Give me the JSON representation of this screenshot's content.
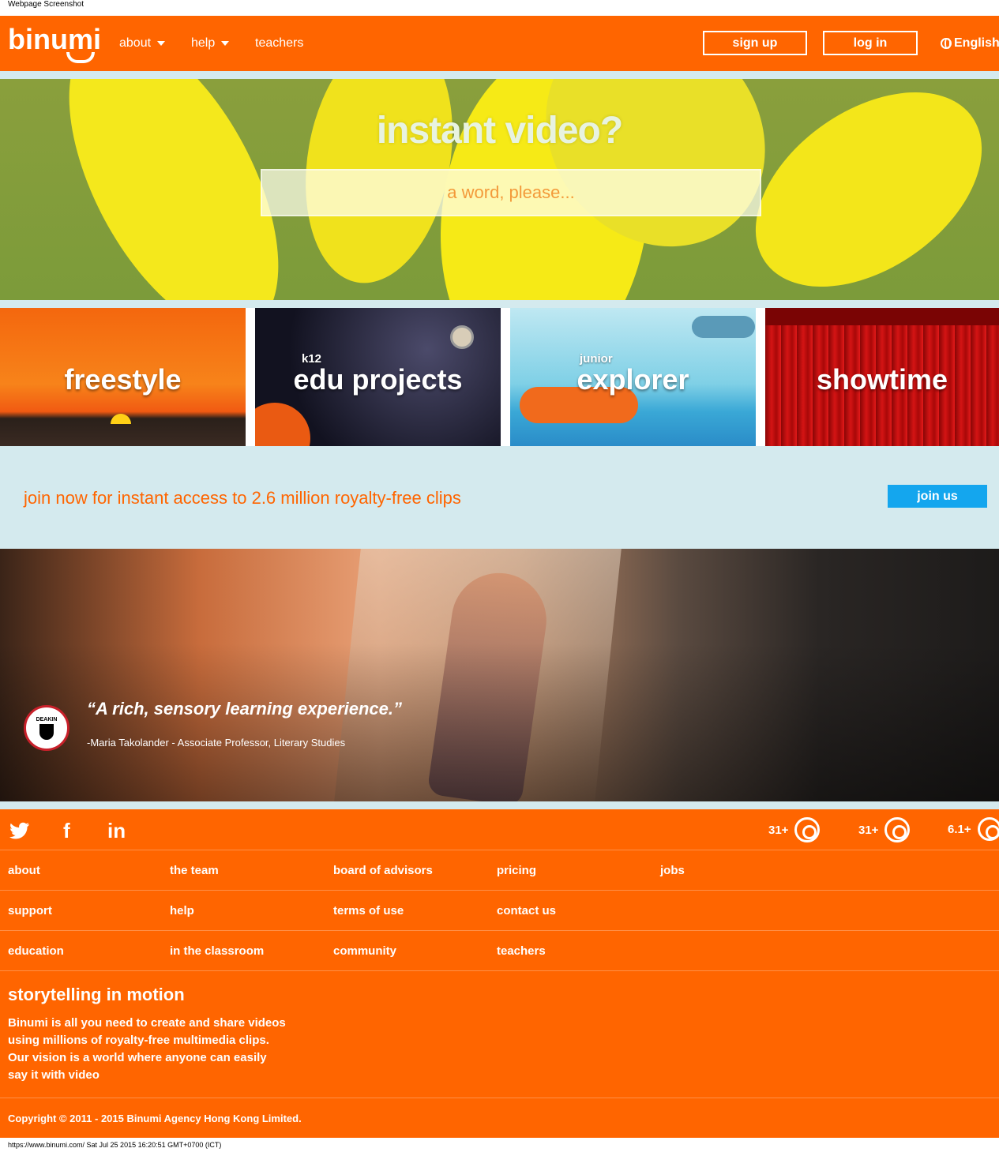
{
  "browser_caption": "Webpage Screenshot",
  "status_line": "https://www.binumi.com/ Sat Jul 25 2015 16:20:51 GMT+0700 (ICT)",
  "header": {
    "logo": "binumi",
    "nav": {
      "about": "about",
      "help": "help",
      "teachers": "teachers"
    },
    "signup": "sign up",
    "login": "log in",
    "language": "English"
  },
  "hero": {
    "title": "instant video?",
    "search_placeholder": "a word, please..."
  },
  "tiles": [
    {
      "label": "freestyle",
      "sub": ""
    },
    {
      "label": "edu projects",
      "sub": "k12"
    },
    {
      "label": "explorer",
      "sub": "junior"
    },
    {
      "label": "showtime",
      "sub": ""
    }
  ],
  "join": {
    "text": "join now for instant access to 2.6 million royalty-free clips",
    "button": "join us"
  },
  "testimonial": {
    "logo_text": "DEAKIN",
    "quote": "“A rich, sensory learning experience.”",
    "attribution": "-Maria Takolander - Associate Professor, Literary Studies"
  },
  "footer": {
    "social": {
      "twitter": "twitter-icon",
      "facebook": "f",
      "linkedin": "in"
    },
    "browsers": [
      {
        "version": "31+",
        "icon": "chrome-icon"
      },
      {
        "version": "31+",
        "icon": "firefox-icon"
      },
      {
        "version": "6.1+",
        "icon": "safari-icon"
      }
    ],
    "rows": [
      [
        "about",
        "the team",
        "board of advisors",
        "pricing",
        "jobs"
      ],
      [
        "support",
        "help",
        "terms of use",
        "contact us"
      ],
      [
        "education",
        "in the classroom",
        "community",
        "teachers"
      ]
    ],
    "tagline": "storytelling in motion",
    "about_lines": [
      "Binumi is all you need to create and share videos",
      "using millions of royalty-free multimedia clips.",
      "Our vision is a world where anyone can easily",
      "say it with video"
    ],
    "copyright": "Copyright © 2011 - 2015 Binumi Agency Hong Kong Limited."
  },
  "colors": {
    "brand": "#ff6500",
    "band": "#d4eaee",
    "join_button": "#14a6ee"
  }
}
